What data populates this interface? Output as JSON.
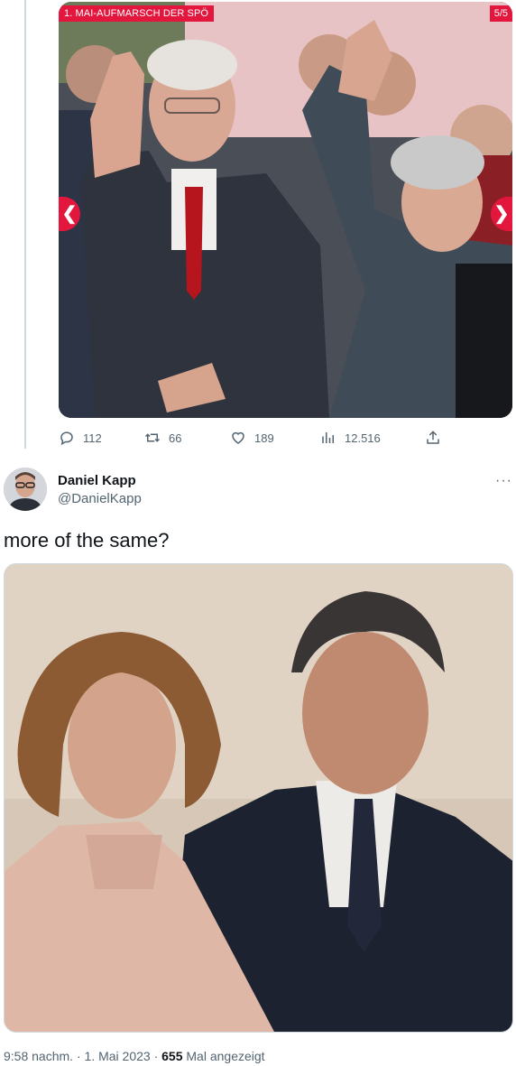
{
  "quoted": {
    "slide_tag": "1. MAI-AUFMARSCH DER SPÖ",
    "slide_count": "5/5",
    "prev_glyph": "❮",
    "next_glyph": "❯",
    "accent": "#e3173e"
  },
  "actions": {
    "replies": "112",
    "retweets": "66",
    "likes": "189",
    "views": "12.516"
  },
  "author": {
    "name": "Daniel Kapp",
    "handle": "@DanielKapp",
    "more_glyph": "···"
  },
  "tweet": {
    "text": "more of the same?"
  },
  "meta": {
    "time": "9:58 nachm.",
    "separator": " · ",
    "date": "1. Mai 2023",
    "views_count": "655",
    "views_label": " Mal angezeigt"
  },
  "icons": {
    "reply": "reply-icon",
    "retweet": "retweet-icon",
    "like": "heart-icon",
    "views": "analytics-icon",
    "share": "share-icon"
  }
}
